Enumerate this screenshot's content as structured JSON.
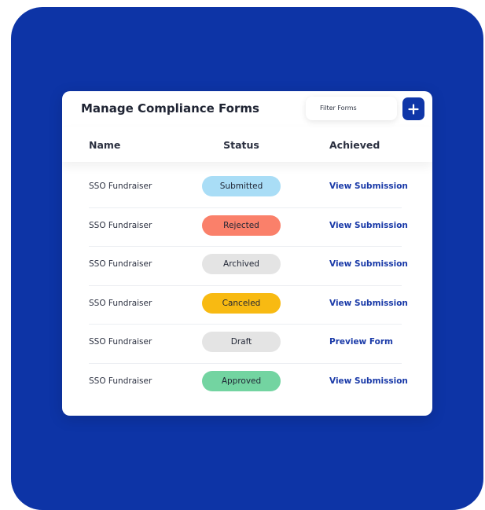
{
  "card": {
    "title": "Manage Compliance Forms",
    "filter_placeholder": "Filter Forms",
    "add_icon": "plus-icon"
  },
  "table": {
    "headers": [
      "Name",
      "Status",
      "Achieved"
    ],
    "rows": [
      {
        "name": "SSO Fundraiser",
        "status": "Submitted",
        "status_color": "#a9ddf6",
        "action": "View Submission"
      },
      {
        "name": "SSO Fundraiser",
        "status": "Rejected",
        "status_color": "#fa806a",
        "action": "View Submission"
      },
      {
        "name": "SSO Fundraiser",
        "status": "Archived",
        "status_color": "#e4e4e4",
        "action": "View Submission"
      },
      {
        "name": "SSO Fundraiser",
        "status": "Canceled",
        "status_color": "#f8ba12",
        "action": "View Submission"
      },
      {
        "name": "SSO Fundraiser",
        "status": "Draft",
        "status_color": "#e4e4e4",
        "action": "Preview Form"
      },
      {
        "name": "SSO Fundraiser",
        "status": "Approved",
        "status_color": "#73d4a1",
        "action": "View Submission"
      }
    ]
  },
  "colors": {
    "backdrop": "#0d34a6",
    "accent": "#0f36a8",
    "link": "#1a3aa8"
  }
}
